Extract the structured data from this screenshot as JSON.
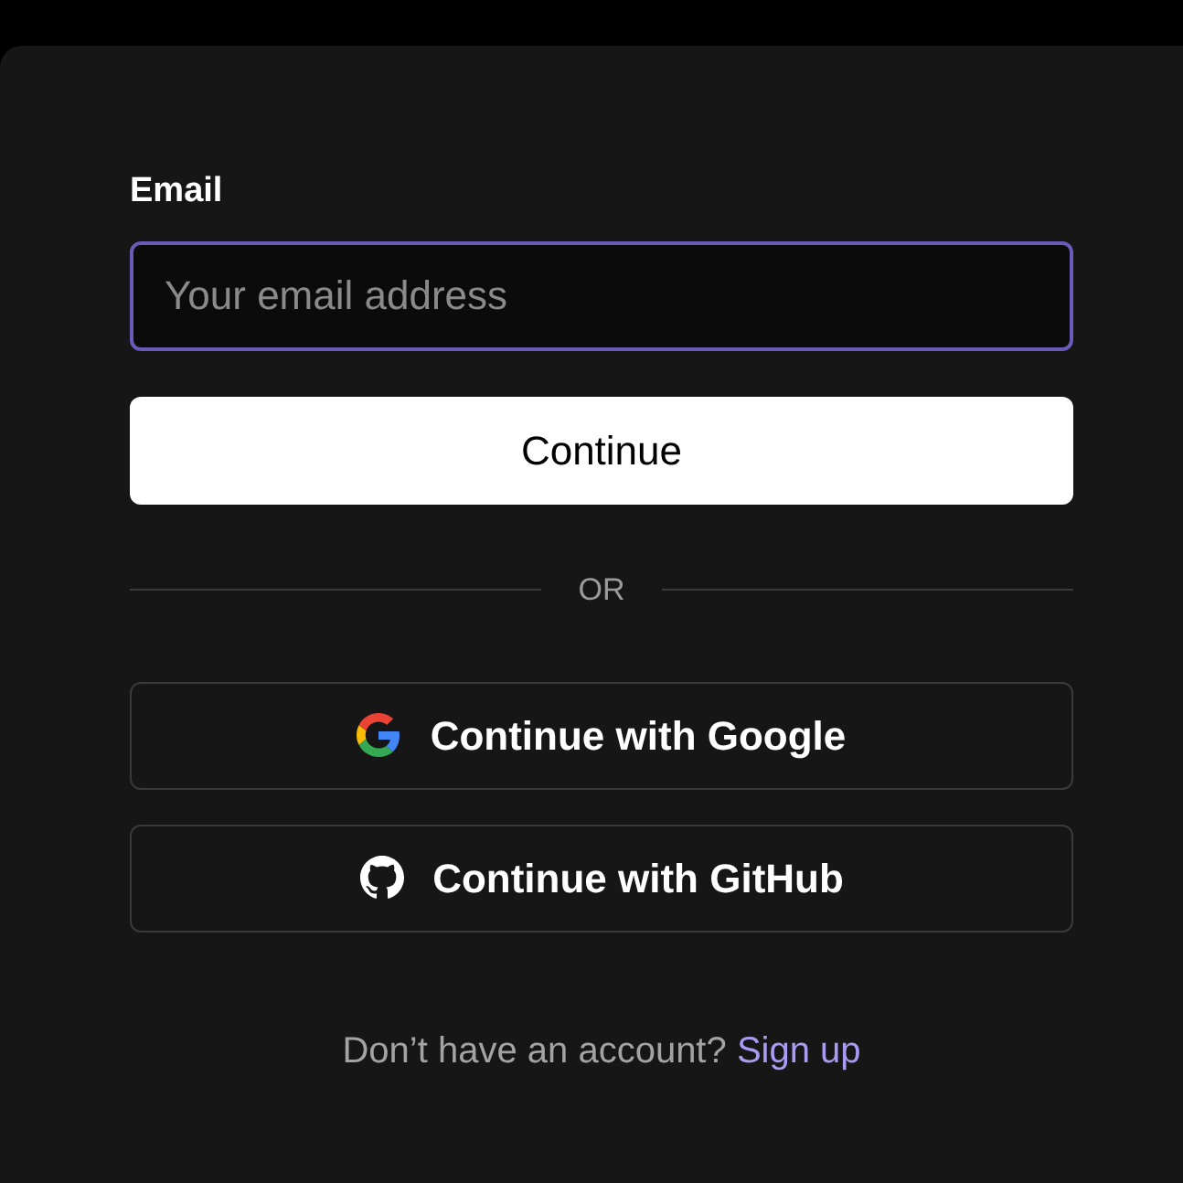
{
  "email_field": {
    "label": "Email",
    "placeholder": "Your email address",
    "focused": true
  },
  "continue_button": {
    "label": "Continue"
  },
  "divider": {
    "label": "OR"
  },
  "providers": [
    {
      "kind": "google",
      "label": "Continue with Google"
    },
    {
      "kind": "github",
      "label": "Continue with GitHub"
    }
  ],
  "footer": {
    "text": "Don’t have an account?",
    "link": "Sign up"
  }
}
